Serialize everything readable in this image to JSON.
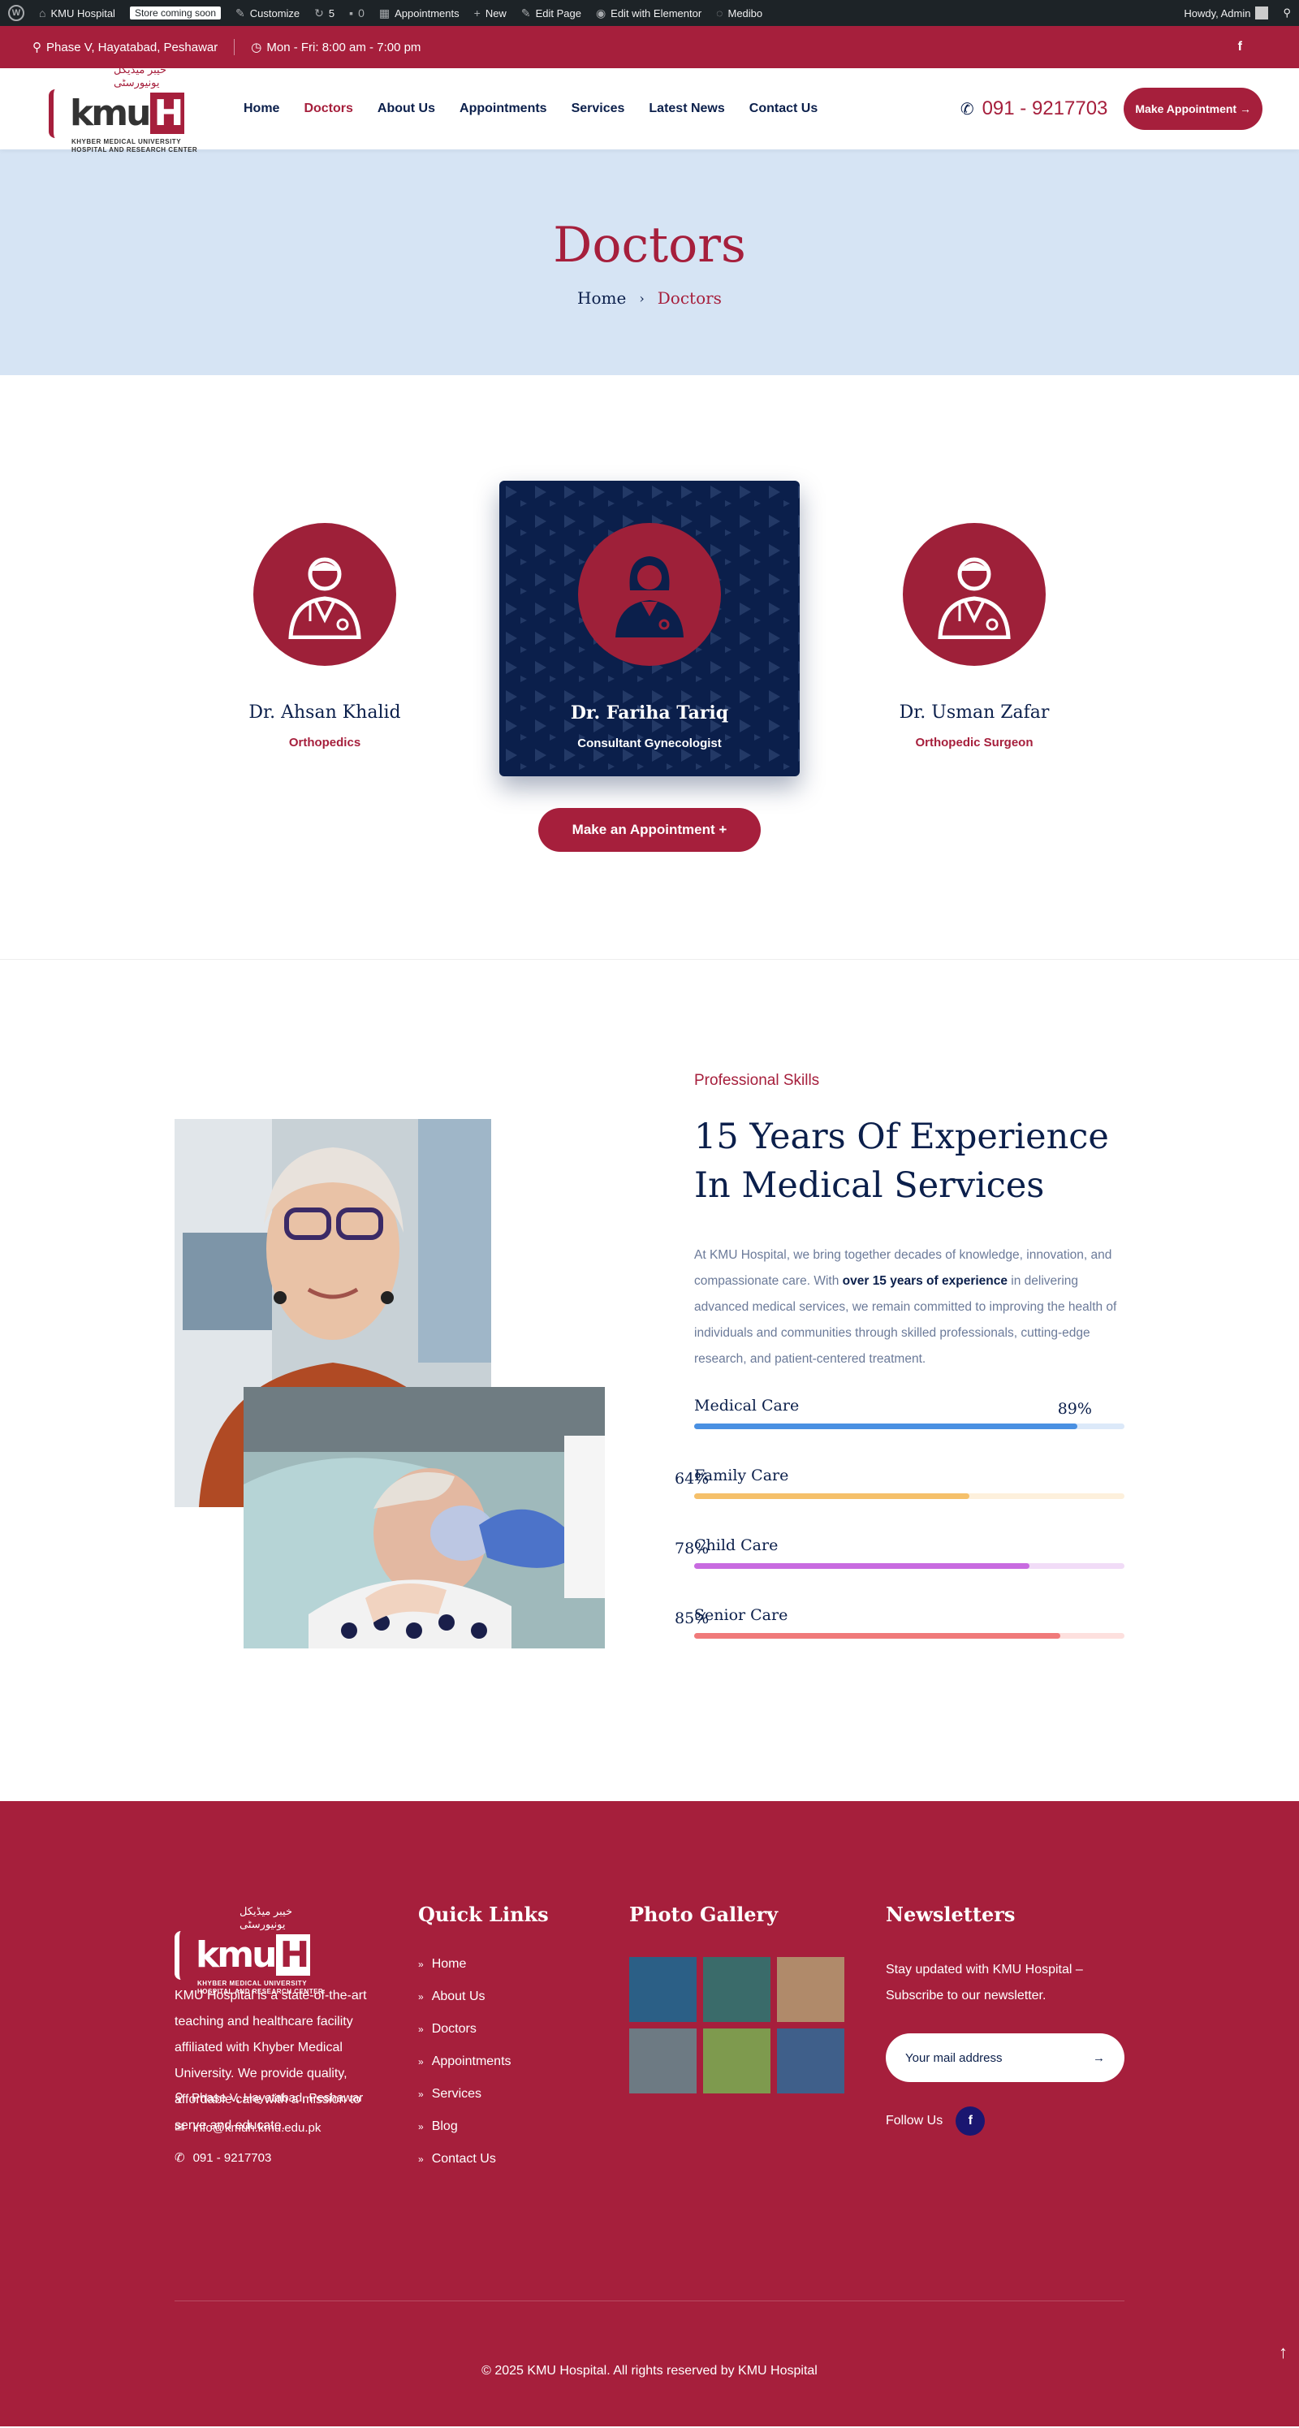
{
  "adminbar": {
    "site": "KMU Hospital",
    "store_badge": "Store coming soon",
    "customize": "Customize",
    "updates": "5",
    "comments": "0",
    "appointments": "Appointments",
    "new": "New",
    "edit_page": "Edit Page",
    "elementor": "Edit with Elementor",
    "theme": "Medibo",
    "howdy": "Howdy, Admin"
  },
  "topbar": {
    "address": "Phase V, Hayatabad, Peshawar",
    "hours": "Mon - Fri: 8:00 am - 7:00 pm",
    "social": "f"
  },
  "header": {
    "logo_urdu": "خیبر میڈیکل یونیورسٹی",
    "logo_text": "kmu",
    "logo_h": "H",
    "logo_sub1": "KHYBER MEDICAL UNIVERSITY",
    "logo_sub2": "HOSPITAL AND RESEARCH CENTER",
    "nav": [
      "Home",
      "Doctors",
      "About Us",
      "Appointments",
      "Services",
      "Latest News",
      "Contact Us"
    ],
    "phone": "091 - 9217703",
    "cta": "Make Appointment →"
  },
  "pagetitle": {
    "title": "Doctors",
    "crumb_home": "Home",
    "crumb_current": "Doctors"
  },
  "doctors": {
    "list": [
      {
        "name": "Dr. Ahsan Khalid",
        "spec": "Orthopedics"
      },
      {
        "name": "Dr. Fariha Tariq",
        "spec": "Consultant Gynecologist"
      },
      {
        "name": "Dr. Usman Zafar",
        "spec": "Orthopedic Surgeon"
      }
    ],
    "cta": "Make an Appointment +"
  },
  "skills": {
    "eyebrow": "Professional Skills",
    "title_1": "15 Years Of Experience",
    "title_2": "In Medical Services",
    "para_1": "At KMU Hospital, we bring together decades of knowledge, innovation, and compassionate care. With ",
    "para_bold": "over 15 years of experience",
    "para_2": " in delivering advanced medical services, we remain committed to improving the health of individuals and communities through skilled professionals, cutting-edge research, and patient-centered treatment.",
    "bars": [
      {
        "label": "Medical Care",
        "value": 89,
        "pct": "89%",
        "color": "#4a90e2",
        "track": "#dce9f9"
      },
      {
        "label": "Family Care",
        "value": 64,
        "pct": "64%",
        "color": "#f5c06a",
        "track": "#fdf0dc"
      },
      {
        "label": "Child Care",
        "value": 78,
        "pct": "78%",
        "color": "#c86be0",
        "track": "#f1dcf7"
      },
      {
        "label": "Senior Care",
        "value": 85,
        "pct": "85%",
        "color": "#f07a7a",
        "track": "#fde0de"
      }
    ]
  },
  "footer": {
    "about": "KMU Hospital is a state-of-the-art teaching and healthcare facility affiliated with Khyber Medical University. We provide quality, affordable care with a mission to serve and educate.",
    "address": "Phase V, Hayatabad, Peshawar",
    "email": "info@kmuh.kmu.edu.pk",
    "phone": "091 - 9217703",
    "quick_title": "Quick Links",
    "quick_links": [
      "Home",
      "About Us",
      "Doctors",
      "Appointments",
      "Services",
      "Blog",
      "Contact Us"
    ],
    "gallery_title": "Photo Gallery",
    "gallery_colors": [
      "#2b5f86",
      "#3a6b6a",
      "#b08a6a",
      "#6d7a83",
      "#7e9a4e",
      "#3f5f8a"
    ],
    "nl_title": "Newsletters",
    "nl_text": "Stay updated with KMU Hospital – Subscribe to our newsletter.",
    "nl_placeholder": "Your mail address",
    "follow": "Follow Us",
    "fb": "f",
    "copyright": "© 2025 KMU Hospital. All rights reserved by KMU Hospital"
  },
  "colors": {
    "brand": "#a61f3c",
    "navy": "#0b1f4b",
    "title_bg": "#d6e4f4"
  }
}
